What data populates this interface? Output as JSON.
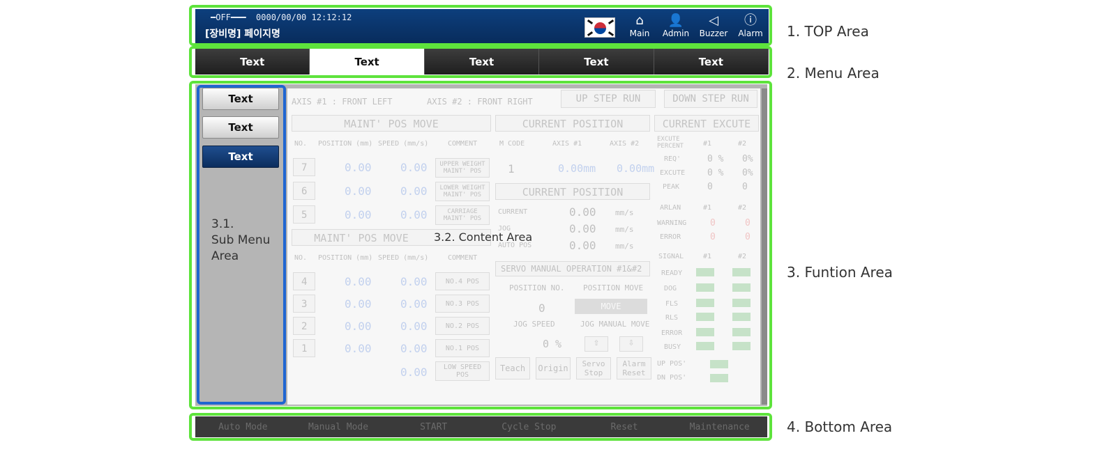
{
  "top": {
    "status_off": "━OFF━━━",
    "datetime": "0000/00/00 12:12:12",
    "page_title": "[장비명] 페이지명",
    "buttons": [
      {
        "label": "Main",
        "icon": "home-icon"
      },
      {
        "label": "Admin",
        "icon": "user-icon"
      },
      {
        "label": "Buzzer",
        "icon": "speaker-icon"
      },
      {
        "label": "Alarm",
        "icon": "alert-icon"
      }
    ]
  },
  "menu": {
    "items": [
      "Text",
      "Text",
      "Text",
      "Text",
      "Text"
    ]
  },
  "submenu": {
    "items": [
      "Text",
      "Text",
      "Text"
    ],
    "area_label": "3.1.\nSub Menu\nArea"
  },
  "content": {
    "area_label": "3.2. Content Area",
    "axis1": "AXIS #1 : FRONT LEFT",
    "axis2": "AXIS #2 : FRONT RIGHT",
    "up_step": "UP STEP RUN",
    "down_step": "DOWN STEP RUN",
    "maint_title": "MAINT' POS MOVE",
    "maint_title2": "MAINT' POS MOVE",
    "col_no": "NO.",
    "col_position": "POSITION (mm)",
    "col_speed": "SPEED (mm/s)",
    "col_comment": "COMMENT",
    "upper_rows": [
      {
        "no": "7",
        "position": "0.00",
        "speed": "0.00",
        "comment": "UPPER WEIGHT MAINT' POS"
      },
      {
        "no": "6",
        "position": "0.00",
        "speed": "0.00",
        "comment": "LOWER WEIGHT MAINT' POS"
      },
      {
        "no": "5",
        "position": "0.00",
        "speed": "0.00",
        "comment": "CARRIAGE MAINT' POS"
      }
    ],
    "lower_rows": [
      {
        "no": "4",
        "position": "0.00",
        "speed": "0.00",
        "comment": "NO.4 POS"
      },
      {
        "no": "3",
        "position": "0.00",
        "speed": "0.00",
        "comment": "NO.3 POS"
      },
      {
        "no": "2",
        "position": "0.00",
        "speed": "0.00",
        "comment": "NO.2 POS"
      },
      {
        "no": "1",
        "position": "0.00",
        "speed": "0.00",
        "comment": "NO.1 POS"
      },
      {
        "no": "",
        "position": "",
        "speed": "0.00",
        "comment": "LOW SPEED POS"
      }
    ],
    "current_position_title": "CURRENT POSITION",
    "current_position_title2": "CURRENT POSITION",
    "m_code": "M CODE",
    "axis_col1": "AXIS #1",
    "axis_col2": "AXIS #2",
    "m_code_value": "1",
    "axis1_value": "0.00mm",
    "axis2_value": "0.00mm",
    "cp_rows": [
      {
        "label": "CURRENT",
        "value": "0.00",
        "unit": "mm/s"
      },
      {
        "label": "JOG",
        "value": "0.00",
        "unit": "mm/s"
      },
      {
        "label": "AUTO POS",
        "value": "0.00",
        "unit": "mm/s"
      }
    ],
    "servo_title": "SERVO MANUAL OPERATION #1&#2",
    "position_no": "POSITION NO.",
    "position_move": "POSITION MOVE",
    "position_no_value": "0",
    "move_label": "MOVE",
    "jog_speed": "JOG SPEED",
    "jog_manual_move": "JOG MANUAL MOVE",
    "jog_speed_value": "0 %",
    "action_buttons": [
      "Teach",
      "Origin",
      "Servo Stop",
      "Alarm Reset"
    ],
    "current_excute_title": "CURRENT EXCUTE",
    "excute_percent": "EXCUTE PERCENT",
    "col_1": "#1",
    "col_2": "#2",
    "excute_rows": [
      {
        "label": "REQ'",
        "v1": "0 %",
        "v2": "0%"
      },
      {
        "label": "EXCUTE",
        "v1": "0 %",
        "v2": "0%"
      },
      {
        "label": "PEAK",
        "v1": "0",
        "v2": "0"
      }
    ],
    "arlan": "ARLAN",
    "arlan_rows": [
      {
        "label": "WARNING",
        "v1": "0",
        "v2": "0"
      },
      {
        "label": "ERROR",
        "v1": "0",
        "v2": "0"
      }
    ],
    "signal": "SIGNAL",
    "signal_rows": [
      "READY",
      "DOG",
      "FLS",
      "RLS",
      "ERROR",
      "BUSY"
    ],
    "up_pos": "UP POS'",
    "dn_pos": "DN POS'"
  },
  "bottom": {
    "items": [
      "Auto Mode",
      "Manual Mode",
      "START",
      "Cycle Stop",
      "Reset",
      "Maintenance"
    ]
  },
  "annotations": {
    "top": "1. TOP Area",
    "menu": "2. Menu Area",
    "function": "3. Funtion Area",
    "bottom": "4. Bottom Area"
  },
  "colors": {
    "highlight": "#5ee33c",
    "submenu_highlight": "#1f66d1",
    "top_bg": "#0b3570",
    "active_submenu": "#1f4e8f"
  }
}
